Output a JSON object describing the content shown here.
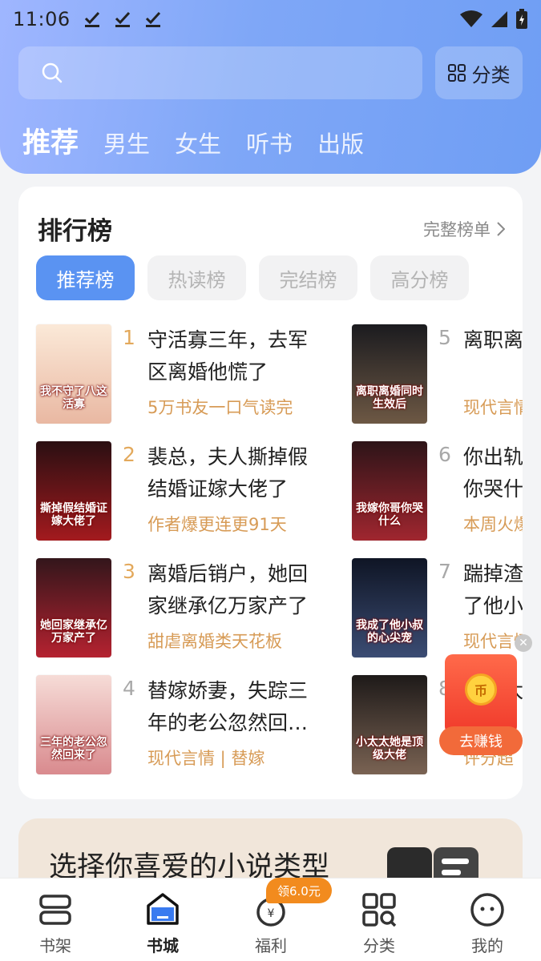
{
  "status_bar": {
    "time": "11:06"
  },
  "header": {
    "category_label": "分类",
    "tabs": [
      {
        "label": "推荐",
        "active": true
      },
      {
        "label": "男生",
        "active": false
      },
      {
        "label": "女生",
        "active": false
      },
      {
        "label": "听书",
        "active": false
      },
      {
        "label": "出版",
        "active": false
      }
    ]
  },
  "ranking": {
    "title": "排行榜",
    "full_list_label": "完整榜单",
    "chips": [
      {
        "label": "推荐榜",
        "active": true
      },
      {
        "label": "热读榜",
        "active": false
      },
      {
        "label": "完结榜",
        "active": false
      },
      {
        "label": "高分榜",
        "active": false
      }
    ],
    "books": [
      {
        "rank": "1",
        "title": "守活寡三年，去军区离婚他慌了",
        "tag": "5万书友一口气读完",
        "cover_text": "我不守了八这活寡",
        "cover_colors": [
          "#fbe9d8",
          "#e9b8a2"
        ]
      },
      {
        "rank": "2",
        "title": "裴总，夫人撕掉假结婚证嫁大佬了",
        "tag": "作者爆更连更91天",
        "cover_text": "撕掉假结婚证嫁大佬了",
        "cover_colors": [
          "#2a0f12",
          "#a31a1e"
        ]
      },
      {
        "rank": "3",
        "title": "离婚后销户，她回家继承亿万家产了",
        "tag": "甜虐离婚类天花板",
        "cover_text": "她回家继承亿万家产了",
        "cover_colors": [
          "#33161b",
          "#b52230"
        ]
      },
      {
        "rank": "4",
        "title": "替嫁娇妻，失踪三年的老公忽然回…",
        "tag": "现代言情 | 替嫁",
        "cover_text": "三年的老公忽然回来了",
        "cover_colors": [
          "#f6dcd7",
          "#d98a8e"
        ]
      },
      {
        "rank": "5",
        "title": "离职离婚后，前…",
        "tag": "现代言情",
        "cover_text": "离职离婚同时生效后",
        "cover_colors": [
          "#1b1b1f",
          "#6d5844"
        ]
      },
      {
        "rank": "6",
        "title": "你出轨，我嫁你哥你哭什么",
        "tag": "本周火爆",
        "cover_text": "我嫁你哥你哭什么",
        "cover_colors": [
          "#2d1418",
          "#a0262f"
        ]
      },
      {
        "rank": "7",
        "title": "踹掉渣男后，我成了他小叔…",
        "tag": "现代言情",
        "cover_text": "我成了他小叔的心尖宠",
        "cover_colors": [
          "#0f1525",
          "#3b4c73"
        ]
      },
      {
        "rank": "8",
        "title": "小太太她是顶级大佬",
        "tag": "评分超",
        "cover_text": "小太太她是顶级大佬",
        "cover_colors": [
          "#1e1a19",
          "#7a6353"
        ]
      }
    ]
  },
  "reward": {
    "label": "去赚钱",
    "coin": "币"
  },
  "genre_banner": {
    "title": "选择你喜爱的小说类型"
  },
  "bottom_nav": {
    "badge": "领6.0元",
    "items": [
      {
        "label": "书架",
        "icon": "bookshelf-icon",
        "active": false
      },
      {
        "label": "书城",
        "icon": "bookstore-icon",
        "active": true
      },
      {
        "label": "福利",
        "icon": "welfare-icon",
        "active": false
      },
      {
        "label": "分类",
        "icon": "category-icon",
        "active": false
      },
      {
        "label": "我的",
        "icon": "profile-icon",
        "active": false
      }
    ]
  }
}
